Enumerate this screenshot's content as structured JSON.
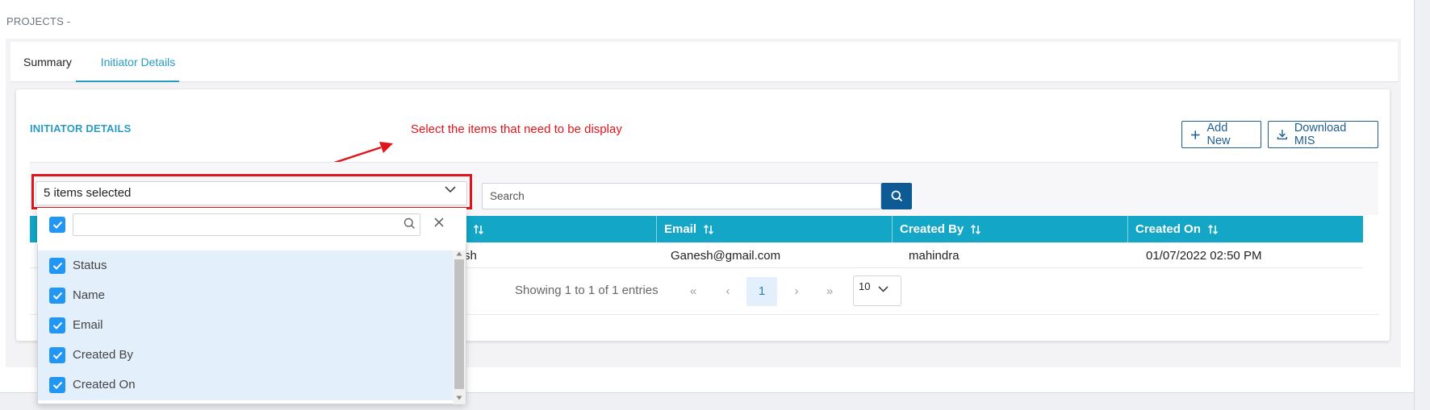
{
  "page": {
    "title": "PROJECTS -"
  },
  "tabs": [
    {
      "label": "Summary"
    },
    {
      "label": "Initiator Details"
    }
  ],
  "section": {
    "title": "INITIATOR DETAILS"
  },
  "annotation": {
    "text": "Select the items that need to be display",
    "color": "#e0141b"
  },
  "buttons": {
    "add_new": "Add New",
    "download_mis": "Download MIS"
  },
  "column_select": {
    "value": "5 items selected",
    "filter_placeholder": "",
    "options": [
      "Status",
      "Name",
      "Email",
      "Created By",
      "Created On"
    ]
  },
  "search": {
    "placeholder": "Search"
  },
  "table": {
    "headers": [
      "Email",
      "Created By",
      "Created On"
    ],
    "rows": [
      {
        "name_fragment": "sh",
        "email": "Ganesh@gmail.com",
        "created_by": "mahindra",
        "created_on": "01/07/2022 02:50 PM"
      }
    ]
  },
  "pagination": {
    "info": "Showing 1 to 1 of 1 entries",
    "first": "«",
    "prev": "‹",
    "current_page": "1",
    "next": "›",
    "last": "»",
    "page_size": "10"
  },
  "colors": {
    "accent": "#2a9bc4",
    "header_bg": "#13a6c6",
    "primary_button": "#0e5a94",
    "checkbox": "#2196f3"
  },
  "icons": [
    "plus-icon",
    "download-icon",
    "chevron-down-icon",
    "search-icon",
    "sort-icon",
    "close-icon",
    "check-icon"
  ]
}
